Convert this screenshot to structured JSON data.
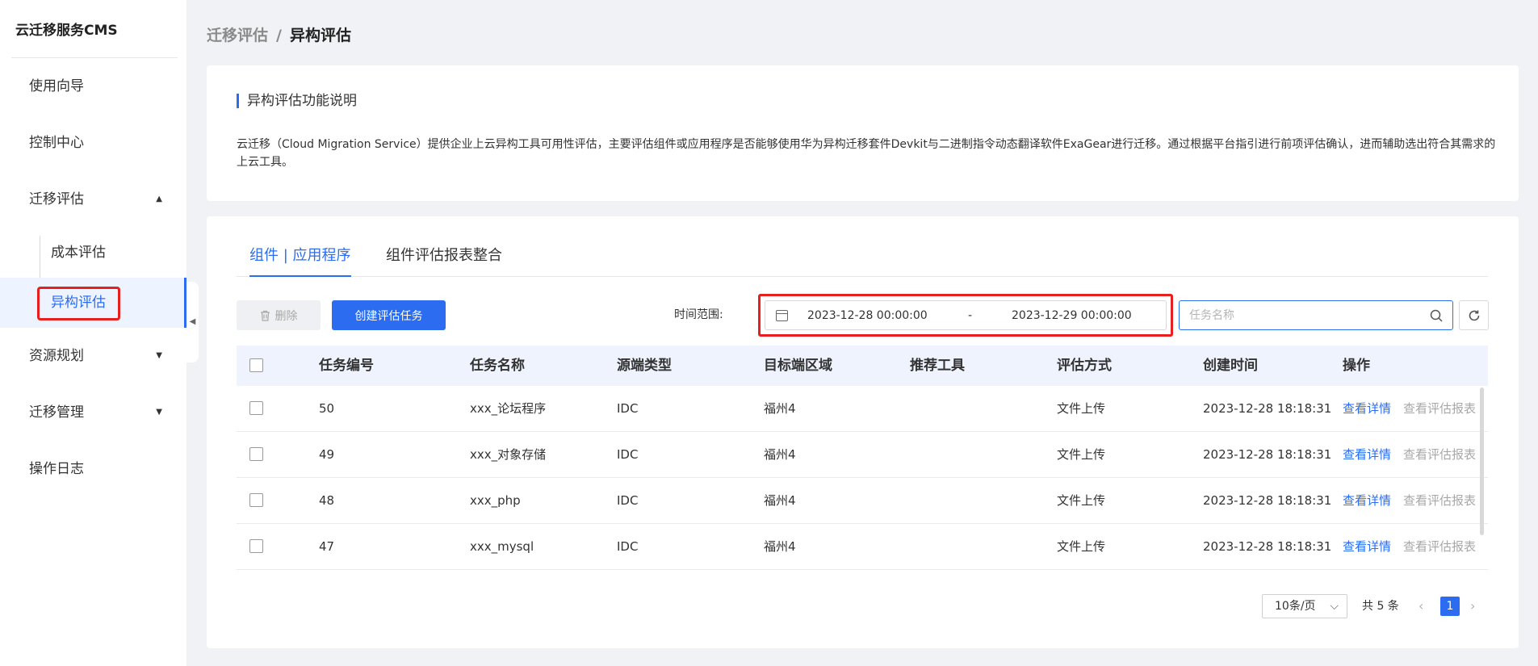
{
  "app": {
    "title": "云迁移服务CMS"
  },
  "sidebar": {
    "items": [
      {
        "label": "使用向导"
      },
      {
        "label": "控制中心"
      },
      {
        "label": "迁移评估",
        "caret": "▲"
      },
      {
        "label": "资源规划",
        "caret": "▼"
      },
      {
        "label": "迁移管理",
        "caret": "▼"
      },
      {
        "label": "操作日志"
      }
    ],
    "sub_items": [
      {
        "label": "成本评估"
      },
      {
        "label": "异构评估"
      }
    ],
    "collapse_glyph": "◀"
  },
  "breadcrumb": {
    "parent": "迁移评估",
    "separator": "/",
    "current": "异构评估"
  },
  "info": {
    "title": "异构评估功能说明",
    "text": "云迁移（Cloud Migration Service）提供企业上云异构工具可用性评估，主要评估组件或应用程序是否能够使用华为异构迁移套件Devkit与二进制指令动态翻译软件ExaGear进行迁移。通过根据平台指引进行前项评估确认，进而辅助选出符合其需求的上云工具。"
  },
  "tabs": [
    {
      "label": "组件 | 应用程序"
    },
    {
      "label": "组件评估报表整合"
    }
  ],
  "toolbar": {
    "delete_label": "删除",
    "create_label": "创建评估任务",
    "range_label": "时间范围:",
    "range_start": "2023-12-28 00:00:00",
    "range_sep": "-",
    "range_end": "2023-12-29 00:00:00",
    "search_placeholder": "任务名称"
  },
  "table": {
    "headers": [
      "任务编号",
      "任务名称",
      "源端类型",
      "目标端区域",
      "推荐工具",
      "评估方式",
      "创建时间",
      "操作"
    ],
    "rows": [
      {
        "id": "50",
        "name": "xxx_论坛程序",
        "source": "IDC",
        "region": "福州4",
        "tool": "",
        "method": "文件上传",
        "created": "2023-12-28 18:18:31",
        "action_detail": "查看详情",
        "action_report": "查看评估报表"
      },
      {
        "id": "49",
        "name": "xxx_对象存储",
        "source": "IDC",
        "region": "福州4",
        "tool": "",
        "method": "文件上传",
        "created": "2023-12-28 18:18:31",
        "action_detail": "查看详情",
        "action_report": "查看评估报表"
      },
      {
        "id": "48",
        "name": "xxx_php",
        "source": "IDC",
        "region": "福州4",
        "tool": "",
        "method": "文件上传",
        "created": "2023-12-28 18:18:31",
        "action_detail": "查看详情",
        "action_report": "查看评估报表"
      },
      {
        "id": "47",
        "name": "xxx_mysql",
        "source": "IDC",
        "region": "福州4",
        "tool": "",
        "method": "文件上传",
        "created": "2023-12-28 18:18:31",
        "action_detail": "查看详情",
        "action_report": "查看评估报表"
      }
    ]
  },
  "pagination": {
    "page_size": "10条/页",
    "total": "共 5 条",
    "current_page": "1",
    "prev": "‹",
    "next": "›"
  },
  "colors": {
    "primary": "#2b6cf0",
    "highlight": "#e6201e"
  }
}
